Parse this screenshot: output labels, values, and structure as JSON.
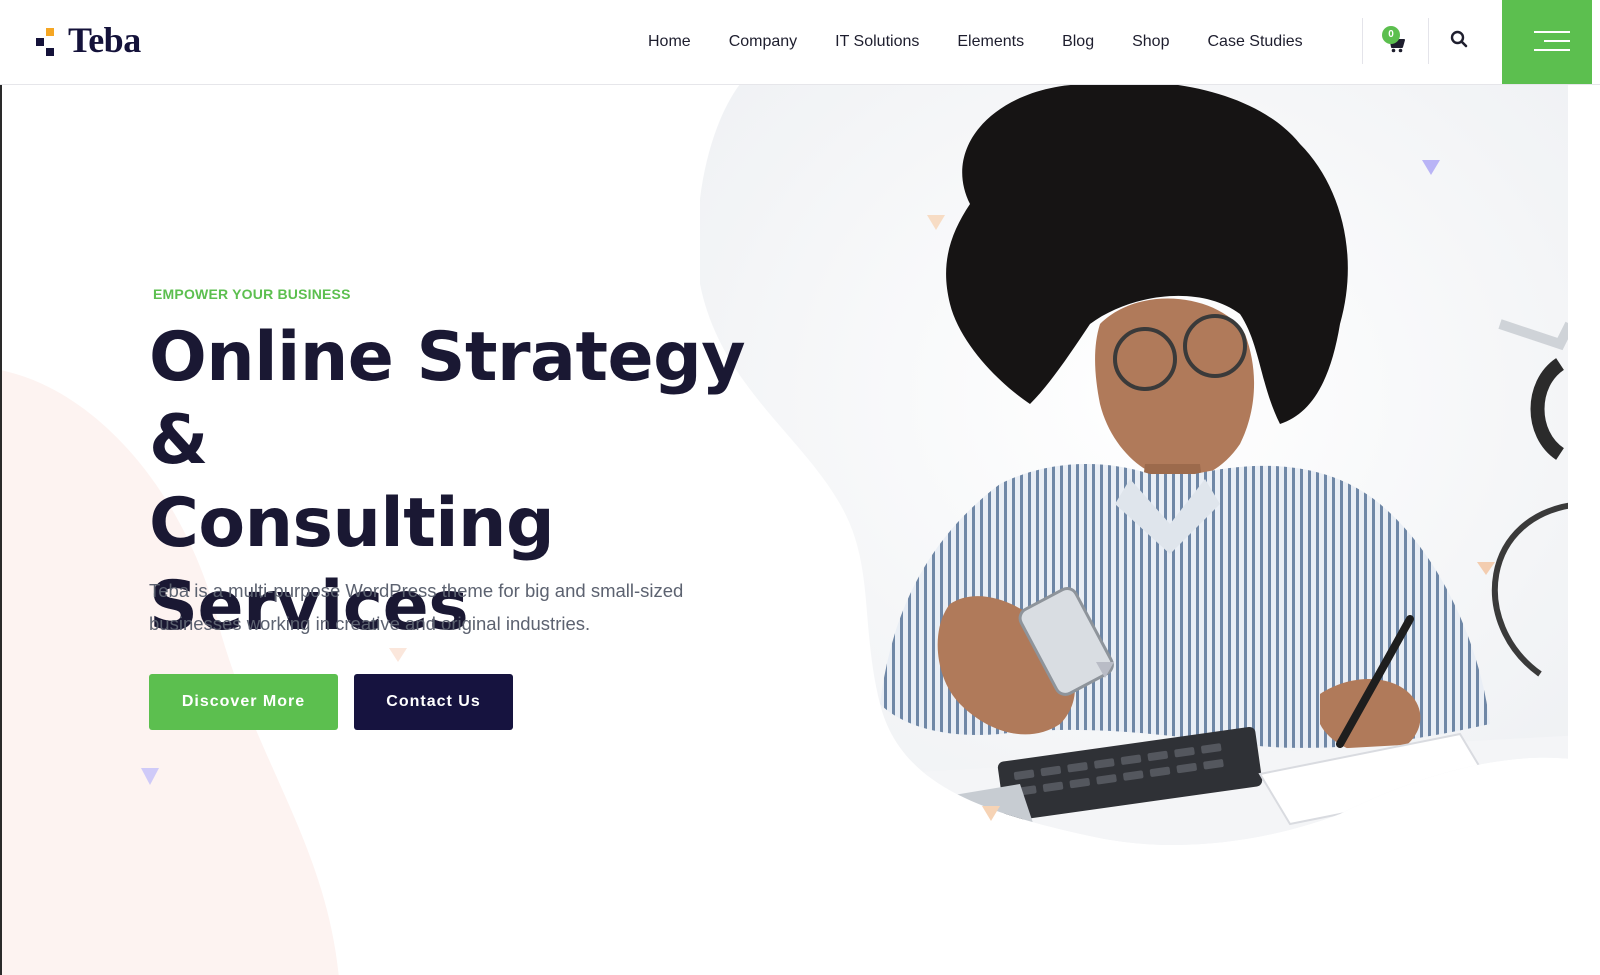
{
  "brand": {
    "name": "Teba",
    "accent_color": "#5cbf4f",
    "navy_color": "#16133f",
    "logo_orange": "#f5a623"
  },
  "nav": {
    "items": [
      {
        "label": "Home"
      },
      {
        "label": "Company"
      },
      {
        "label": "IT Solutions"
      },
      {
        "label": "Elements"
      },
      {
        "label": "Blog"
      },
      {
        "label": "Shop"
      },
      {
        "label": "Case Studies"
      }
    ],
    "cart_count": "0",
    "icons": {
      "cart": "shopping-cart-icon",
      "search": "search-icon",
      "menu": "hamburger-menu-icon"
    }
  },
  "hero": {
    "eyebrow": "EMPOWER YOUR BUSINESS",
    "title_lines": [
      "Online Strategy &",
      "Consulting",
      "Services"
    ],
    "description_lines": [
      "Teba is a multi-purpose WordPress theme for big and small-sized",
      "businesses working in creative and original industries."
    ],
    "primary_button": "Discover More",
    "secondary_button": "Contact Us"
  }
}
